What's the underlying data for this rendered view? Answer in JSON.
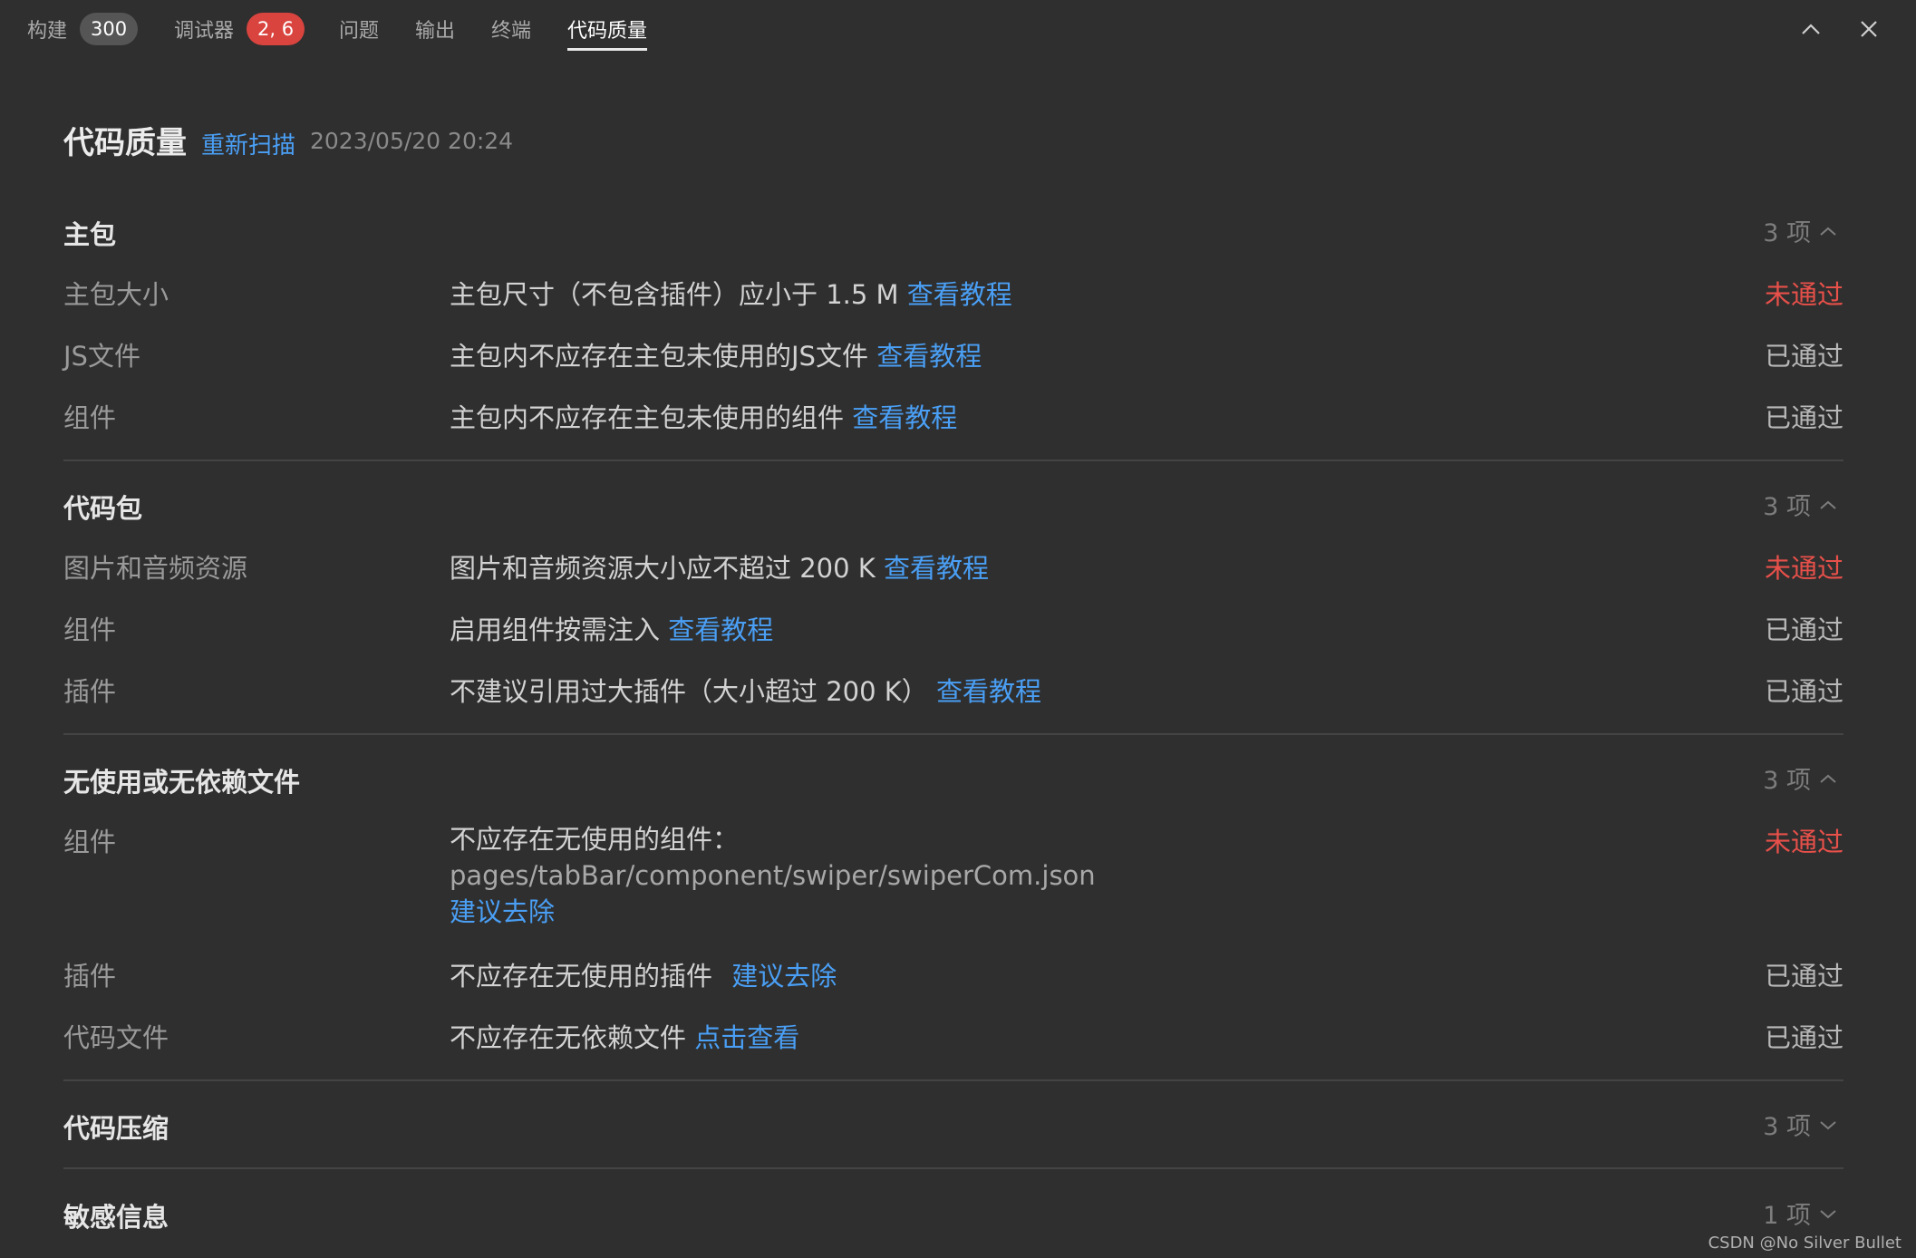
{
  "tabs": [
    {
      "label": "构建",
      "badge": "300",
      "badge_color": "#555555"
    },
    {
      "label": "调试器",
      "badge": "2, 6",
      "badge_color": "#d9443f"
    },
    {
      "label": "问题"
    },
    {
      "label": "输出"
    },
    {
      "label": "终端"
    },
    {
      "label": "代码质量",
      "active": true
    }
  ],
  "window_controls": {
    "collapse_icon": "chevron-up-icon",
    "close_icon": "close-icon"
  },
  "header": {
    "title": "代码质量",
    "rescan_label": "重新扫描",
    "timestamp": "2023/05/20 20:24"
  },
  "colors": {
    "link": "#4a9ff5",
    "fail": "#e8504a",
    "pass": "#b8b8b8",
    "background": "#2f2f2f"
  },
  "sections": [
    {
      "title": "主包",
      "count": "3 项",
      "expanded": true,
      "rows": [
        {
          "label": "主包大小",
          "desc": "主包尺寸（不包含插件）应小于 1.5 M",
          "link": "查看教程",
          "status": "未通过"
        },
        {
          "label": "JS文件",
          "desc": "主包内不应存在主包未使用的JS文件",
          "link": "查看教程",
          "status": "已通过"
        },
        {
          "label": "组件",
          "desc": "主包内不应存在主包未使用的组件",
          "link": "查看教程",
          "status": "已通过"
        }
      ]
    },
    {
      "title": "代码包",
      "count": "3 项",
      "expanded": true,
      "rows": [
        {
          "label": "图片和音频资源",
          "desc": "图片和音频资源大小应不超过 200 K",
          "link": "查看教程",
          "status": "未通过"
        },
        {
          "label": "组件",
          "desc": "启用组件按需注入",
          "link": "查看教程",
          "status": "已通过"
        },
        {
          "label": "插件",
          "desc": "不建议引用过大插件（大小超过 200 K）",
          "link": "查看教程",
          "status": "已通过"
        }
      ]
    },
    {
      "title": "无使用或无依赖文件",
      "count": "3 项",
      "expanded": true,
      "rows": [
        {
          "label": "组件",
          "desc": "不应存在无使用的组件：",
          "path": "pages/tabBar/component/swiper/swiperCom.json",
          "link": "建议去除",
          "status": "未通过"
        },
        {
          "label": "插件",
          "desc": "不应存在无使用的插件",
          "link": "建议去除",
          "status": "已通过"
        },
        {
          "label": "代码文件",
          "desc": "不应存在无依赖文件",
          "link": "点击查看",
          "status": "已通过"
        }
      ]
    },
    {
      "title": "代码压缩",
      "count": "3 项",
      "expanded": false
    },
    {
      "title": "敏感信息",
      "count": "1 项",
      "expanded": false
    }
  ],
  "watermark": "CSDN @No Silver Bullet"
}
